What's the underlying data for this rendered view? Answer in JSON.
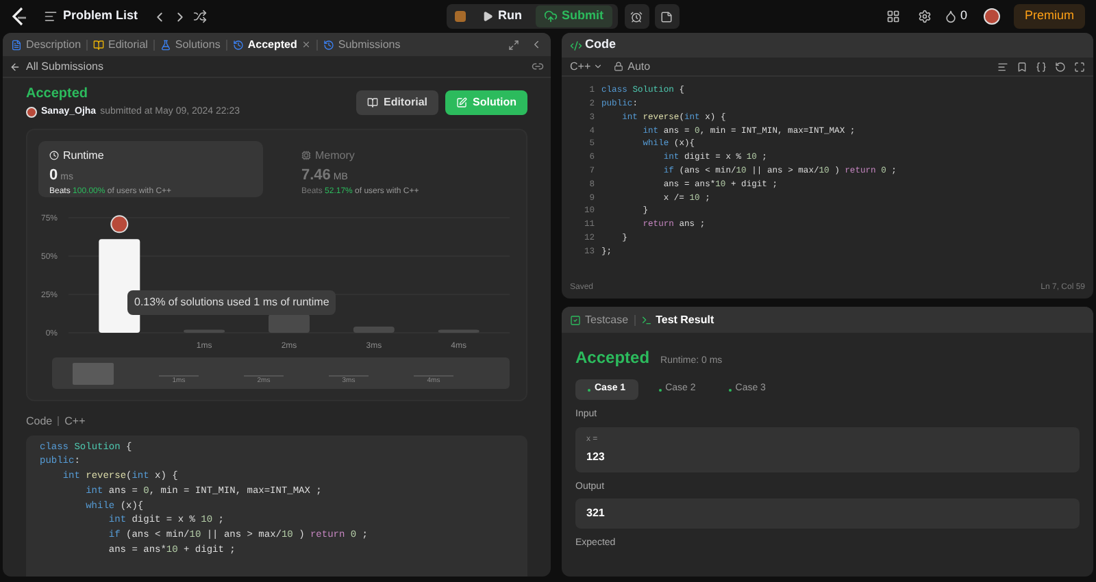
{
  "top_bar": {
    "title": "Problem List",
    "run": "Run",
    "submit": "Submit",
    "streak": "0",
    "premium": "Premium"
  },
  "left_panel": {
    "tabs": [
      {
        "label": "Description",
        "selected": false,
        "closable": false
      },
      {
        "label": "Editorial",
        "selected": false,
        "closable": false
      },
      {
        "label": "Solutions",
        "selected": false,
        "closable": false
      },
      {
        "label": "Accepted",
        "selected": true,
        "closable": true
      },
      {
        "label": "Submissions",
        "selected": false,
        "closable": false
      }
    ],
    "back_link": "All Submissions",
    "result": {
      "status": "Accepted",
      "user": "Sanay_Ojha",
      "submitted": "submitted at May 09, 2024 22:23",
      "buttons": [
        {
          "label": "Editorial",
          "kind": "secondary"
        },
        {
          "label": "Solution",
          "kind": "primary"
        }
      ]
    },
    "stats": [
      {
        "label": "Runtime",
        "value": "0",
        "unit": "ms",
        "beats_prefix": "Beats",
        "beats_value": "100.00%",
        "beats_suffix": "of users with C++",
        "selected": true
      },
      {
        "label": "Memory",
        "value": "7.46",
        "unit": "MB",
        "beats_prefix": "Beats",
        "beats_value": "52.17%",
        "beats_suffix": "of users with C++",
        "selected": false
      }
    ],
    "chart_data": {
      "type": "bar",
      "x": [
        0,
        1,
        2,
        3,
        4
      ],
      "xlim": [
        -0.6,
        4.6
      ],
      "values": [
        61,
        2,
        12,
        4,
        2
      ],
      "ylim": [
        0,
        75
      ],
      "yticks": [
        {
          "value": 0,
          "label": "0%"
        },
        {
          "value": 25,
          "label": "25%"
        },
        {
          "value": 50,
          "label": "50%"
        },
        {
          "value": 75,
          "label": "75%"
        }
      ],
      "xticks": [
        {
          "value": 1,
          "label": "1ms"
        },
        {
          "value": 2,
          "label": "2ms"
        },
        {
          "value": 3,
          "label": "3ms"
        },
        {
          "value": 4,
          "label": "4ms"
        }
      ]
    },
    "tooltip": "0.13% of solutions used 1 ms of runtime",
    "overview_labels": [
      "1ms",
      "2ms",
      "3ms",
      "4ms"
    ],
    "code_label": "Code",
    "code_language": "C++",
    "code": [
      "class Solution {",
      "public:",
      "    int reverse(int x) {",
      "        int ans = 0, min = INT_MIN, max=INT_MAX ;",
      "        while (x){",
      "            int digit = x % 10 ;",
      "            if (ans < min/10 || ans > max/10 ) return 0 ;",
      "            ans = ans*10 + digit ;"
    ]
  },
  "editor": {
    "title": "Code",
    "language": "C++",
    "mode": "Auto",
    "lines": [
      {
        "no": "1",
        "text": "class Solution {"
      },
      {
        "no": "2",
        "text": "public:"
      },
      {
        "no": "3",
        "text": "    int reverse(int x) {"
      },
      {
        "no": "4",
        "text": "        int ans = 0, min = INT_MIN, max=INT_MAX ;"
      },
      {
        "no": "5",
        "text": "        while (x){"
      },
      {
        "no": "6",
        "text": "            int digit = x % 10 ;"
      },
      {
        "no": "7",
        "text": "            if (ans < min/10 || ans > max/10 ) return 0 ;"
      },
      {
        "no": "8",
        "text": "            ans = ans*10 + digit ;"
      },
      {
        "no": "9",
        "text": "            x /= 10 ;"
      },
      {
        "no": "10",
        "text": "        }"
      },
      {
        "no": "11",
        "text": "        return ans ;"
      },
      {
        "no": "12",
        "text": "    }"
      },
      {
        "no": "13",
        "text": "};"
      }
    ],
    "status": "Saved",
    "cursor": "Ln 7, Col 59"
  },
  "test_panel": {
    "tabs": [
      {
        "label": "Testcase",
        "selected": false
      },
      {
        "label": "Test Result",
        "selected": true
      }
    ],
    "status": "Accepted",
    "runtime": "Runtime: 0 ms",
    "cases": [
      {
        "label": "Case 1",
        "selected": true
      },
      {
        "label": "Case 2",
        "selected": false
      },
      {
        "label": "Case 3",
        "selected": false
      }
    ],
    "sections": [
      {
        "label": "Input",
        "lines": [
          {
            "kind": "name",
            "text": "x ="
          },
          {
            "kind": "value",
            "text": "123"
          }
        ]
      },
      {
        "label": "Output",
        "lines": [
          {
            "kind": "value",
            "text": "321"
          }
        ]
      },
      {
        "label": "Expected"
      }
    ]
  }
}
